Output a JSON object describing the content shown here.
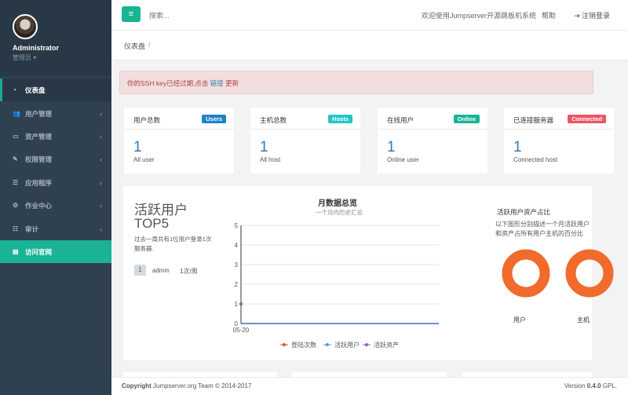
{
  "sidebar": {
    "user_name": "Administrator",
    "user_role": "管理员 ▾",
    "items": [
      {
        "label": "仪表盘",
        "icon": "dashboard-icon",
        "glyph": "◔",
        "chev": ""
      },
      {
        "label": "用户管理",
        "icon": "users-icon",
        "glyph": "👥",
        "chev": "‹"
      },
      {
        "label": "资产管理",
        "icon": "assets-icon",
        "glyph": "▭",
        "chev": "‹"
      },
      {
        "label": "权限管理",
        "icon": "permission-icon",
        "glyph": "✎",
        "chev": "‹"
      },
      {
        "label": "应用程序",
        "icon": "applications-icon",
        "glyph": "☰",
        "chev": "‹"
      },
      {
        "label": "作业中心",
        "icon": "jobs-icon",
        "glyph": "⚙",
        "chev": "‹"
      },
      {
        "label": "审计",
        "icon": "audit-icon",
        "glyph": "☷",
        "chev": "‹"
      },
      {
        "label": "访问官网",
        "icon": "website-icon",
        "glyph": "▤",
        "chev": ""
      }
    ]
  },
  "topbar": {
    "menu_glyph": "≡",
    "search_placeholder": "搜索...",
    "welcome": "欢迎使用Jumpserver开源跳板机系统",
    "help": "帮助",
    "logout": "⇥ 注销登录"
  },
  "breadcrumb": {
    "current": "仪表盘",
    "sep": "/"
  },
  "alert": {
    "pre": "你的SSH key已经过期,点击 ",
    "link": "链接",
    "post": " 更新"
  },
  "cards": [
    {
      "title": "用户总数",
      "badge": "Users",
      "badge_color": "#1c84c6",
      "value": "1",
      "sub": "All user"
    },
    {
      "title": "主机总数",
      "badge": "Hosts",
      "badge_color": "#23c6c8",
      "value": "1",
      "sub": "All host"
    },
    {
      "title": "在线用户",
      "badge": "Online",
      "badge_color": "#1ab394",
      "value": "1",
      "sub": "Online user"
    },
    {
      "title": "已连接服务器",
      "badge": "Connected",
      "badge_color": "#ed5565",
      "value": "1",
      "sub": "Connected host"
    }
  ],
  "top5": {
    "title_line1": "活跃用户",
    "title_line2": "TOP5",
    "desc": "过去一周共有1位用户登录1次服务器.",
    "rows": [
      {
        "rank": "1",
        "user": "admin",
        "count": "1次/周"
      }
    ]
  },
  "chart_data": {
    "type": "line",
    "title": "月数据总览",
    "subtitle": "一个月内历史汇总",
    "x": [
      "05-20"
    ],
    "yticks": [
      0,
      1,
      2,
      3,
      4,
      5
    ],
    "ylim": [
      0,
      5
    ],
    "series": [
      {
        "name": "登陆次数",
        "values": [
          1
        ],
        "color": "#e84c3d"
      },
      {
        "name": "活跃用户",
        "values": [
          1
        ],
        "color": "#5a9bd4"
      },
      {
        "name": "活跃资产",
        "values": [
          1
        ],
        "color": "#9b59b6"
      }
    ]
  },
  "share": {
    "title": "活跃用户资产占比",
    "desc": "以下图形分别描述一个月活跃用户和资产占所有用户主机的百分比",
    "labels": [
      "用户",
      "主机"
    ],
    "percents": [
      100,
      100
    ],
    "color": "#f06b2c"
  },
  "footer": {
    "copyright_bold": "Copyright",
    "copyright_rest": " Jumpserver.org Team © 2014-2017",
    "version_pre": "Version ",
    "version_num": "0.4.0",
    "version_post": " GPL."
  }
}
